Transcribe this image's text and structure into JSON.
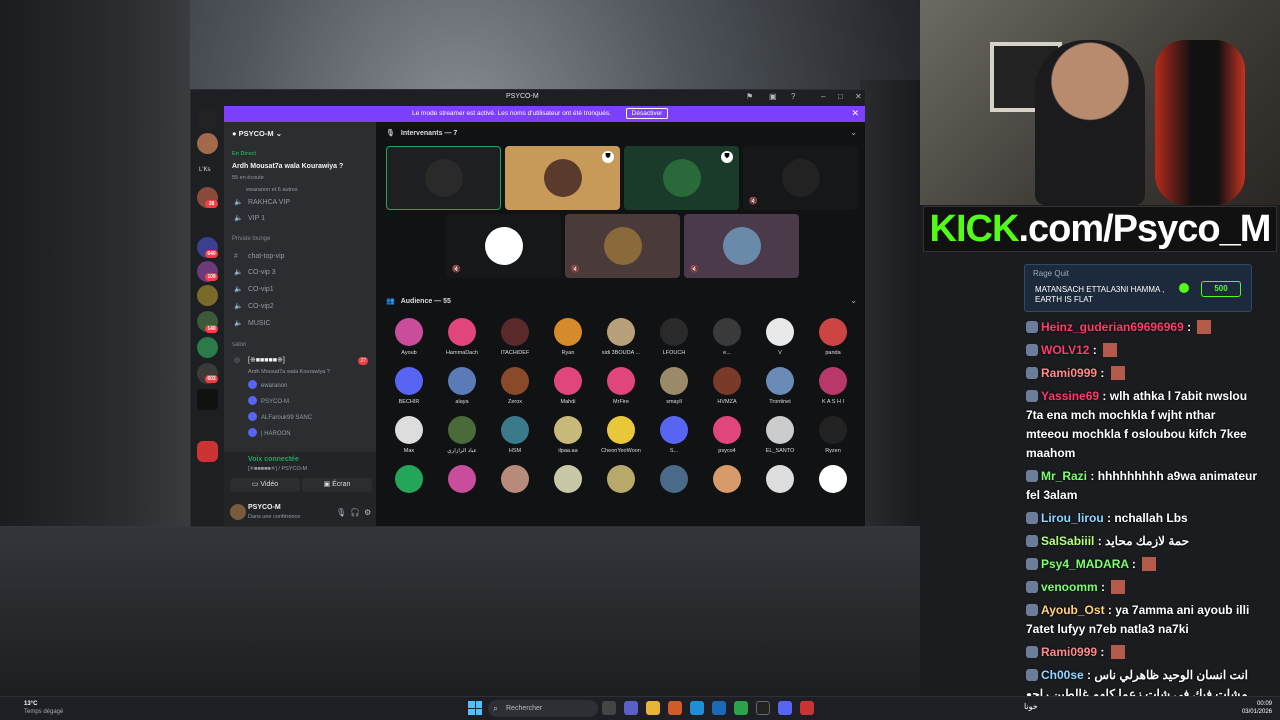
{
  "window": {
    "title": "PSYCO-M"
  },
  "banner": {
    "text": "Le mode streamer est activé. Les noms d'utilisateur ont été tronqués.",
    "button": "Désactiver"
  },
  "sidebar": {
    "server_name": "PSYCO-M",
    "guild_label": "L'Ks",
    "guild_badges": [
      "28",
      "362",
      "640",
      "109",
      "140",
      "603"
    ],
    "live_label": "En Direct",
    "event_title": "Ardh Mousat7a wala Kourawiya ?",
    "event_listeners": "55 en écoute",
    "event_others": "ewaranon et 6 autres",
    "channels": [
      {
        "name": "RAKHCA VIP"
      },
      {
        "name": "VIP 1"
      },
      {
        "name": "chat-top-vip"
      },
      {
        "name": "CO-vip 3"
      },
      {
        "name": "CO-vip1"
      },
      {
        "name": "CO-vip2"
      },
      {
        "name": "MUSIC"
      }
    ],
    "categories": [
      "Private lounge",
      "salon"
    ],
    "stage_channel": "[※■■■■■※]",
    "stage_sub": "Ardh Mousat7a wala Kourawiya ?",
    "stage_badge": "27",
    "members": [
      "ewaranon",
      "PSYCO-M",
      "ALFarouk99 SANC",
      "| HAROON"
    ],
    "voice_connected": "Voix connectée",
    "voice_sub": "[※■■■■■※] / PSYCO-M",
    "video_btn": "Vidéo",
    "screen_btn": "Écran",
    "user_name": "PSYCO-M",
    "user_status": "Dans une conférence"
  },
  "stage": {
    "speakers_title": "Intervenants — 7",
    "audience_title": "Audience — 55",
    "audience": [
      "Ayoub",
      "HammaDach",
      "ITACHIDEF",
      "Ryan",
      "sidi 3BOUDA ...",
      "LFOUCH",
      "e...",
      "V",
      "panda",
      "BECHIR",
      "alaya",
      "Zerox",
      "Mahdi",
      "MrFire",
      "smayll",
      "HVMZA",
      "Trontinet",
      "K A S H I",
      "Max",
      "عباد الرازاري",
      "HSM",
      "ilpaa.aa",
      "CheonYeoWoon",
      "S...",
      "psyco4",
      "EL_SANTO",
      "Ryzen"
    ]
  },
  "stream": {
    "brand": "KICK",
    "url_rest": ".com/Psyco_M",
    "rage_title": "Rage Quit",
    "rage_text": "MATANSACH ETTALA3NI HAMMA , EARTH IS FLAT",
    "rage_cost": "500"
  },
  "chat": [
    {
      "user": "Heinz_guderian69696969",
      "text": "",
      "color": "#ff3b6b"
    },
    {
      "user": "WOLV12",
      "text": "",
      "color": "#ff3b6b"
    },
    {
      "user": "Rami0999",
      "text": "",
      "color": "#ff8a8a"
    },
    {
      "user": "Yassine69",
      "text": "wlh athka l 7abit nwslou 7ta ena mch mochkla f wjht nthar mteeou mochkla f osloubou kifch 7kee maahom",
      "color": "#ff3b6b"
    },
    {
      "user": "Mr_Razi",
      "text": "hhhhhhhhh a9wa animateur fel 3alam",
      "color": "#7bff6b"
    },
    {
      "user": "Lirou_lirou",
      "text": "nchallah Lbs",
      "color": "#8fd7ff"
    },
    {
      "user": "SalSabiiil",
      "text": "حمة لازمك محايد",
      "color": "#b6ff7b"
    },
    {
      "user": "Psy4_MADARA",
      "text": "",
      "color": "#7bff6b"
    },
    {
      "user": "venoomm",
      "text": "",
      "color": "#7bff6b"
    },
    {
      "user": "Ayoub_Ost",
      "text": "ya 7amma ani ayoub illi 7atet lufyy n7eb natla3 na7ki",
      "color": "#ffd27b"
    },
    {
      "user": "Rami0999",
      "text": "",
      "color": "#ff8a8a"
    },
    {
      "user": "Ch00se",
      "text": "انت انسان الوحيد ظاهرلي ناس مشات فيك في شات زعما كلهم غالطين راجع روحك يا",
      "color": "#8fd7ff"
    }
  ],
  "taskbar": {
    "weather_temp": "13°C",
    "weather_desc": "Temps dégagé",
    "search_placeholder": "Rechercher",
    "time": "00:09",
    "date": "03/01/2026",
    "tray_text": "خونا"
  }
}
